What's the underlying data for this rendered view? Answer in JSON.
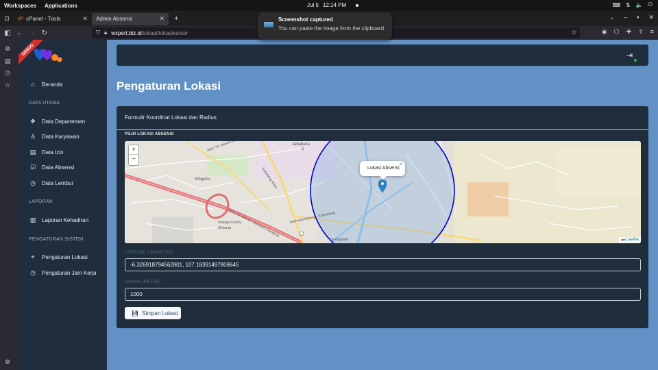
{
  "system_bar": {
    "workspaces": "Workspaces",
    "applications": "Applications",
    "date": "Jul 5",
    "time": "12:14 PM"
  },
  "browser": {
    "tabs": [
      {
        "label": "cPanel - Tools"
      },
      {
        "label": "Admin Absensi"
      }
    ],
    "url_host": "wxpert.biz.id",
    "url_path": "/lokasi/lokasikantor"
  },
  "notification": {
    "title": "Screenshot captured",
    "body": "You can paste the image from the clipboard."
  },
  "sidebar": {
    "ribbon": "DEBUG",
    "items_top": [
      {
        "label": "Beranda",
        "icon": "home-icon"
      }
    ],
    "sections": [
      {
        "heading": "DATA UTAMA",
        "items": [
          {
            "label": "Data Departemen",
            "icon": "sitemap-icon"
          },
          {
            "label": "Data Karyawan",
            "icon": "user-icon"
          },
          {
            "label": "Data Izin",
            "icon": "clipboard-icon"
          },
          {
            "label": "Data Absensi",
            "icon": "calendar-check-icon"
          },
          {
            "label": "Data Lembur",
            "icon": "clock-icon"
          }
        ]
      },
      {
        "heading": "LAPORAN",
        "items": [
          {
            "label": "Laporan Kehadiran",
            "icon": "file-icon"
          }
        ]
      },
      {
        "heading": "PENGATURAN SISTEM",
        "items": [
          {
            "label": "Pengaturan Lokasi",
            "icon": "map-marker-icon"
          },
          {
            "label": "Pengaturan Jam Kerja",
            "icon": "clock-icon"
          }
        ]
      }
    ]
  },
  "main": {
    "page_title": "Pengaturan Lokasi",
    "card_title": "Formulir Koordinat Lokasi dan Radius",
    "map_section_label": "PILIH LOKASI ABSENSI",
    "map": {
      "popup_text": "Lokasi Absensi",
      "attribution": "Leaflet",
      "zoom_in": "+",
      "zoom_out": "−",
      "place_labels": [
        "Jababeka",
        "5",
        "Sibgahu",
        "Orange County",
        "Meikarta",
        "Jalan Tol Jakarta Cikampek",
        "Jalan Tol Jakarta Cikampek Cilangkap",
        "Jalan Kali Malang - Kalimalang",
        "Karangasih",
        "Kaliabang Raya"
      ],
      "circle_color": "#0000cc"
    },
    "latlng_label": "LATITUDE, LONGITUDE",
    "latlng_value": "-6.326918794562801, 107.18391497808645",
    "radius_label": "RADIUS (METER)",
    "radius_value": "1000",
    "save_label": "Simpan Lokasi"
  }
}
